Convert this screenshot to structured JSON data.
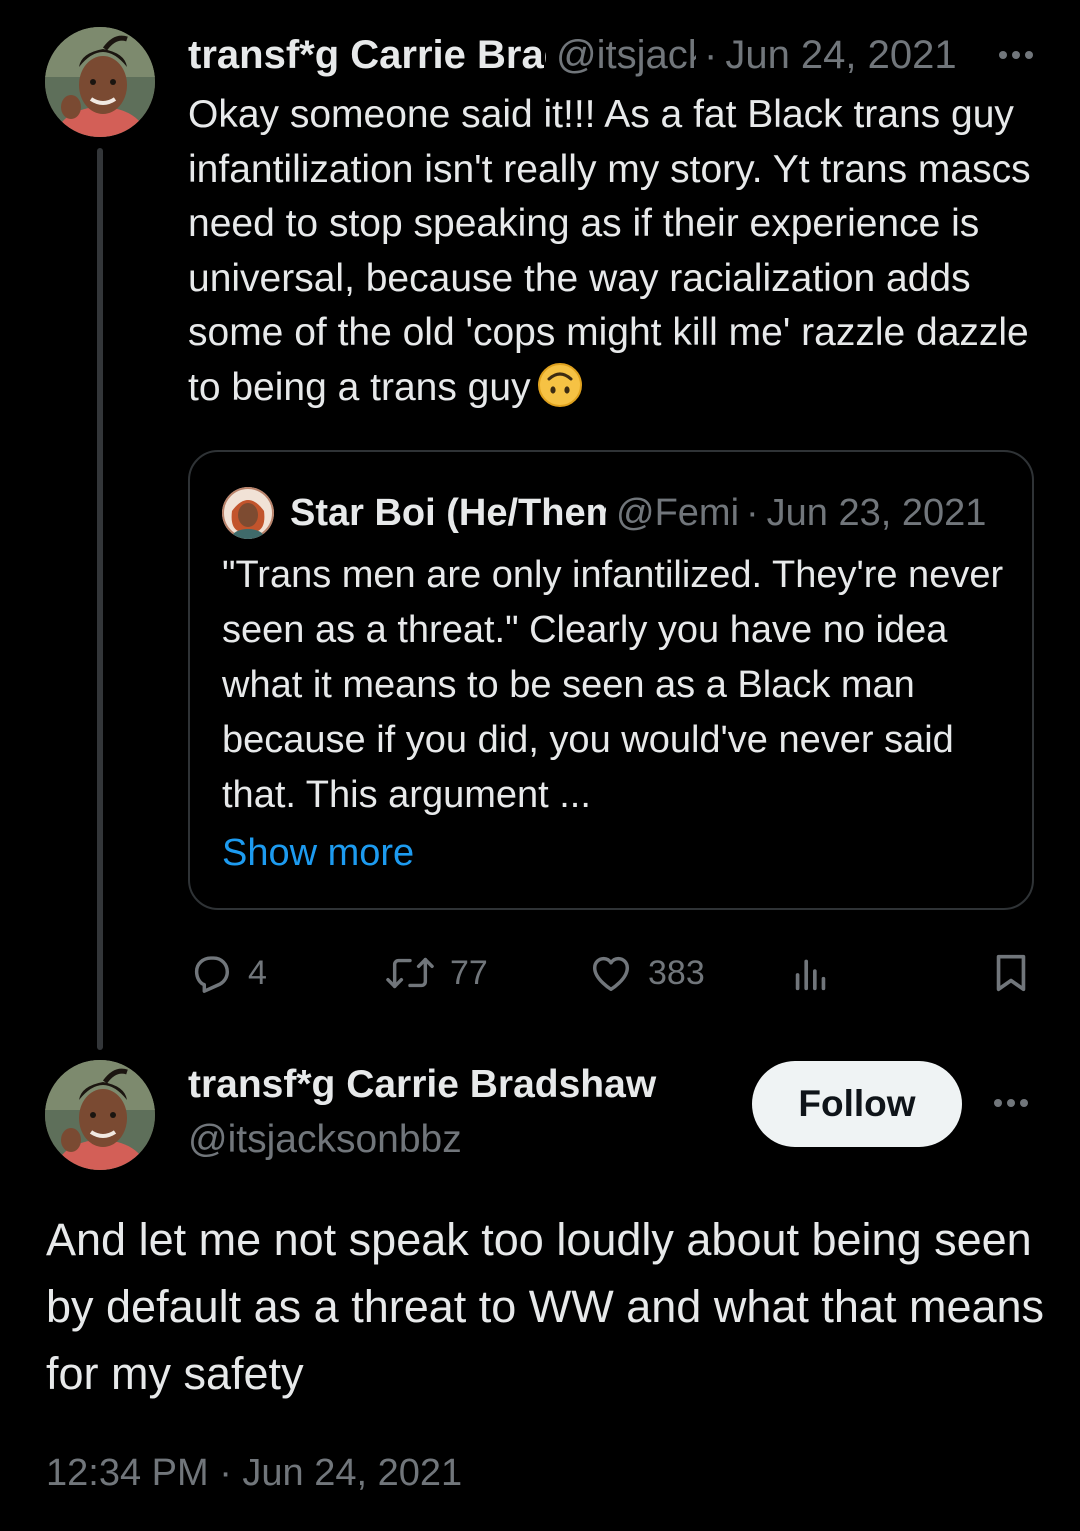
{
  "parent_tweet": {
    "author_name": "transf*g Carrie Bradshaw",
    "handle": "@itsjacksonbbz",
    "separator": "·",
    "date": "Jun 24, 2021",
    "text": "Okay someone said it!!! As a fat Black trans guy infantilization isn't really my story. Yt trans mascs need to stop speaking as if their experience is universal, because the way racialization adds some of the old 'cops might kill me' razzle dazzle to being a trans guy",
    "emoji": "upside-down-face",
    "quoted_tweet": {
      "author_name": "Star Boi (He/Them)",
      "handle": "@Femi",
      "separator": "·",
      "date": "Jun 23, 2021",
      "text": "\"Trans men are only infantilized. They're never seen as a threat.\" Clearly you have no idea what it means to be seen as a Black man because if you did, you would've never said that. This argument ...",
      "show_more_label": "Show more"
    },
    "actions": {
      "replies": "4",
      "reposts": "77",
      "likes": "383"
    }
  },
  "main_tweet": {
    "author_name": "transf*g Carrie Bradshaw",
    "handle": "@itsjacksonbbz",
    "follow_label": "Follow",
    "text": "And let me not speak too loudly about being seen by default as a threat to WW and what that means for my safety",
    "timestamp": "12:34 PM · Jun 24, 2021"
  },
  "colors": {
    "background": "#000000",
    "primary_text": "#e7e9ea",
    "secondary_text": "#71767b",
    "link": "#1d9bf0",
    "border": "#2f3336",
    "follow_button_bg": "#eff3f4"
  }
}
